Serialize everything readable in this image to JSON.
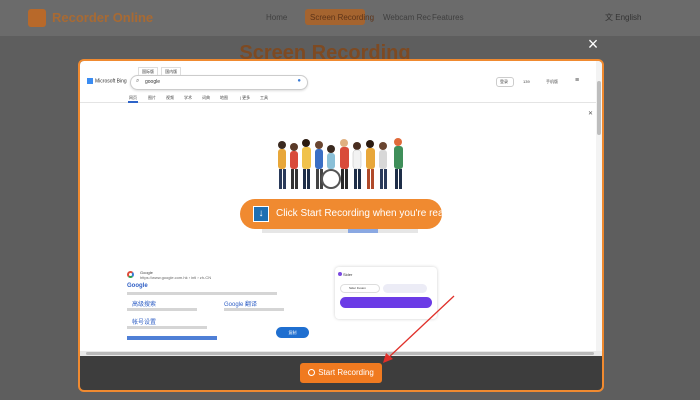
{
  "site": {
    "brand": "Recorder Online",
    "nav": [
      "Home",
      "Screen Recording",
      "Webcam Rec",
      "Features"
    ],
    "language": "English",
    "page_title": "Screen Recording"
  },
  "modal": {
    "close_symbol": "×",
    "banner_text": "Click Start Recording when you're ready",
    "banner_icon": "download-arrow-icon",
    "start_button_label": "Start Recording",
    "accent_color": "#f08a30"
  },
  "captured_screen": {
    "bing_logo": "Microsoft Bing",
    "browser_tabs": [
      "国际版",
      "国内版"
    ],
    "search_query": "google",
    "nav_items": [
      "网页",
      "图片",
      "视频",
      "学术",
      "词典",
      "地图",
      "| 更多",
      "工具"
    ],
    "right_items": [
      "登录",
      "139",
      "手机版"
    ],
    "result_site": "Google",
    "result_url": "https://www.google.com.hk › intl › zh-CN",
    "result_title": "Google",
    "sub_links": [
      "高级搜索",
      "Google 翻译",
      "帐号设置"
    ],
    "card_name": "Sider",
    "card_button_label": "Sider Fusion",
    "blue_button_label": "复制"
  }
}
